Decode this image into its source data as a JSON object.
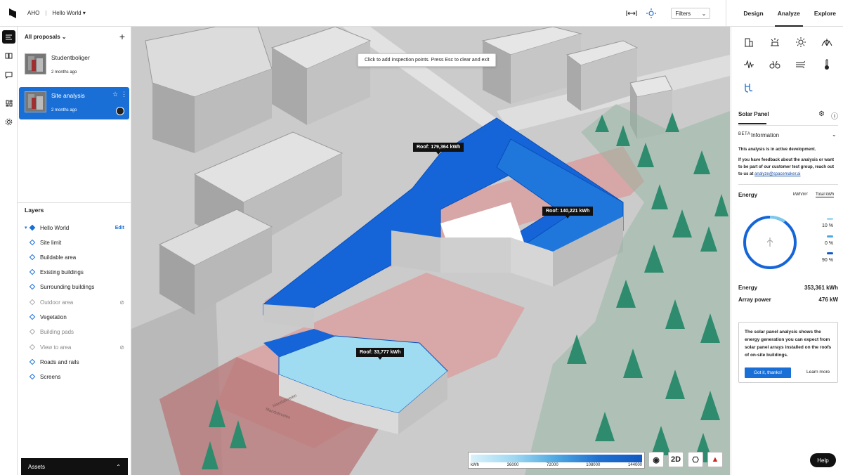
{
  "topbar": {
    "org": "AHO",
    "project": "Hello World",
    "filters_label": "Filters",
    "tabs": [
      {
        "label": "Design"
      },
      {
        "label": "Analyze"
      },
      {
        "label": "Explore"
      }
    ]
  },
  "leftpanel": {
    "proposals_label": "All proposals",
    "proposals": [
      {
        "name": "Studentboliger",
        "date": "2 months ago"
      },
      {
        "name": "Site analysis",
        "date": "2 months ago"
      }
    ],
    "layers_title": "Layers",
    "edit_label": "Edit",
    "layers": [
      {
        "label": "Hello World"
      },
      {
        "label": "Site limit"
      },
      {
        "label": "Buildable area"
      },
      {
        "label": "Existing buildings"
      },
      {
        "label": "Surrounding buildings"
      },
      {
        "label": "Outdoor area"
      },
      {
        "label": "Vegetation"
      },
      {
        "label": "Building pads"
      },
      {
        "label": "View to area"
      },
      {
        "label": "Roads and rails"
      },
      {
        "label": "Screens"
      }
    ],
    "assets_label": "Assets"
  },
  "viewport": {
    "tooltip": "Click to add inspection points. Press Esc to clear and exit",
    "roof_labels": [
      {
        "text": "Roof: 179,364 kWh"
      },
      {
        "text": "Roof: 140,221 kWh"
      },
      {
        "text": "Roof: 33,777 kWh"
      }
    ],
    "street_labels": [
      "Mandalsveien",
      "Mandalsveien"
    ],
    "legend": {
      "ticks": [
        "kWh",
        "36000",
        "72000",
        "108000",
        "144000"
      ]
    },
    "view_2d_label": "2D"
  },
  "rightpanel": {
    "panel_title": "Solar Panel",
    "beta": "BETA",
    "info_title": "Information",
    "info_p1": "This analysis is in active development.",
    "info_p2": "If you have feedback about the analysis or want to be part of our customer test group, reach out to us at",
    "info_email": "analyze@spacemaker.ai",
    "energy_header": "Energy",
    "unit_kwhm2": "kWh/m²",
    "unit_total": "Total kWh",
    "pcts": [
      "10 %",
      "0 %",
      "90 %"
    ],
    "energy_label": "Energy",
    "energy_value": "353,361 kWh",
    "array_label": "Array power",
    "array_value": "476 kW",
    "card_text": "The solar panel analysis shows the energy generation you can expect from solar panel arrays installed on the roofs of on-site buildings.",
    "got_it": "Got it, thanks!",
    "learn_more": "Learn more"
  },
  "help_label": "Help",
  "colors": {
    "accent": "#1a6fd6",
    "roof_blue": "#1565d8",
    "site_red": "#d9a0a0",
    "tree_green": "#2e8b6e"
  }
}
